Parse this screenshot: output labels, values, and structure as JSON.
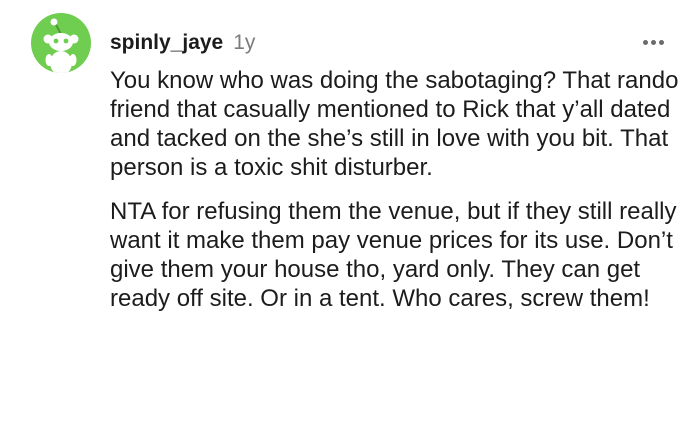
{
  "comment": {
    "avatar_icon": "reddit-snoo-avatar-icon",
    "username": "spinly_jaye",
    "age": "1y",
    "more_icon": "more-options-icon",
    "paragraphs": [
      "You know who was doing the sabotaging? That rando friend that casually mentioned to Rick that y’all dated and tacked on the she’s still in love with you bit. That person is a toxic shit disturber.",
      "NTA for refusing them the venue, but if they still really want it make them pay venue prices for its use. Don’t give them your house tho, yard only. They can get ready off site. Or in a tent. Who cares, screw them!"
    ]
  },
  "colors": {
    "avatar_background": "#6fcd4f",
    "text": "#1c1c1c",
    "meta_text": "#7c7c7c"
  }
}
